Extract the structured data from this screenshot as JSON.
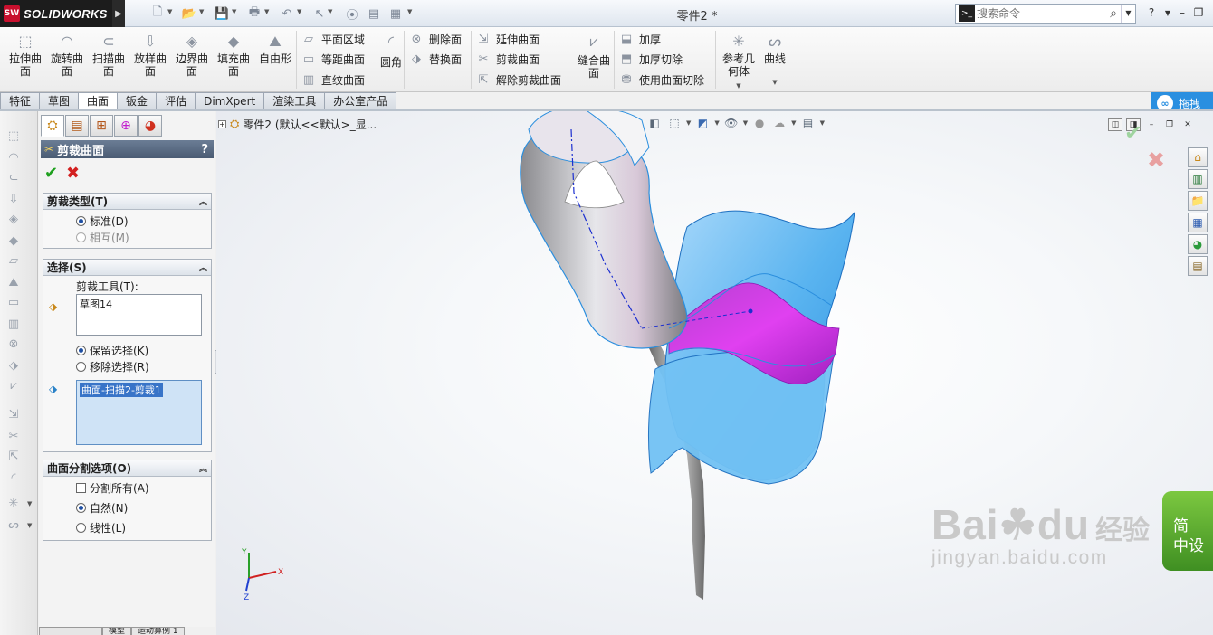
{
  "app": {
    "logo_text": "SOLIDWORKS",
    "logo_mark": "SW",
    "document_title": "零件2 *"
  },
  "search": {
    "placeholder": "搜索命令"
  },
  "ribbon": {
    "big_buttons": [
      {
        "label": "拉伸曲\n面",
        "icon": "extruded-surface-icon"
      },
      {
        "label": "旋转曲\n面",
        "icon": "revolved-surface-icon"
      },
      {
        "label": "扫描曲\n面",
        "icon": "swept-surface-icon"
      },
      {
        "label": "放样曲\n面",
        "icon": "lofted-surface-icon"
      },
      {
        "label": "边界曲\n面",
        "icon": "boundary-surface-icon"
      },
      {
        "label": "填充曲\n面",
        "icon": "filled-surface-icon"
      },
      {
        "label": "自由形",
        "icon": "freeform-icon"
      }
    ],
    "group1": [
      "平面区域",
      "等距曲面",
      "直纹曲面"
    ],
    "fillet": "圆角",
    "group2": [
      "删除面",
      "替换面"
    ],
    "group3": [
      "延伸曲面",
      "剪裁曲面",
      "解除剪裁曲面"
    ],
    "knit": "缝合曲\n面",
    "group4": [
      "加厚",
      "加厚切除",
      "使用曲面切除"
    ],
    "ref_geometry": "参考几\n何体",
    "curves": "曲线",
    "drag_label": "拖拽"
  },
  "tabs": [
    "特征",
    "草图",
    "曲面",
    "钣金",
    "评估",
    "DimXpert",
    "渲染工具",
    "办公室产品"
  ],
  "active_tab": "曲面",
  "panel": {
    "title": "剪裁曲面",
    "help": "?",
    "trim_type": {
      "header": "剪裁类型(T)",
      "options": [
        {
          "label": "标准(D)",
          "selected": true,
          "enabled": true
        },
        {
          "label": "相互(M)",
          "selected": false,
          "enabled": false
        }
      ]
    },
    "selection": {
      "header": "选择(S)",
      "trim_tool_label": "剪裁工具(T):",
      "trim_tool_value": "草图14",
      "options": [
        {
          "label": "保留选择(K)",
          "selected": true
        },
        {
          "label": "移除选择(R)",
          "selected": false
        }
      ],
      "pieces_value": "曲面-扫描2-剪裁1"
    },
    "split": {
      "header": "曲面分割选项(O)",
      "split_all": {
        "label": "分割所有(A)",
        "checked": false
      },
      "options": [
        {
          "label": "自然(N)",
          "selected": true
        },
        {
          "label": "线性(L)",
          "selected": false
        }
      ]
    }
  },
  "bottom_tabs": [
    "",
    "模型",
    "运动算例 1"
  ],
  "tree": {
    "root": "零件2  (默认<<默认>_显..."
  },
  "triad": {
    "x": "X",
    "y": "Y",
    "z": "Z"
  },
  "promo": {
    "line1": "简",
    "line2": "中设"
  },
  "watermark": {
    "brand": "Bai",
    "brand2": "du",
    "cn": "经验",
    "url": "jingyan.baidu.com"
  },
  "colors": {
    "accent": "#2a8fe0",
    "surface_blue": "#5ab4f0",
    "trim_magenta": "#cc22e0",
    "ok_green": "#1ea01e",
    "cancel_red": "#d32020"
  }
}
